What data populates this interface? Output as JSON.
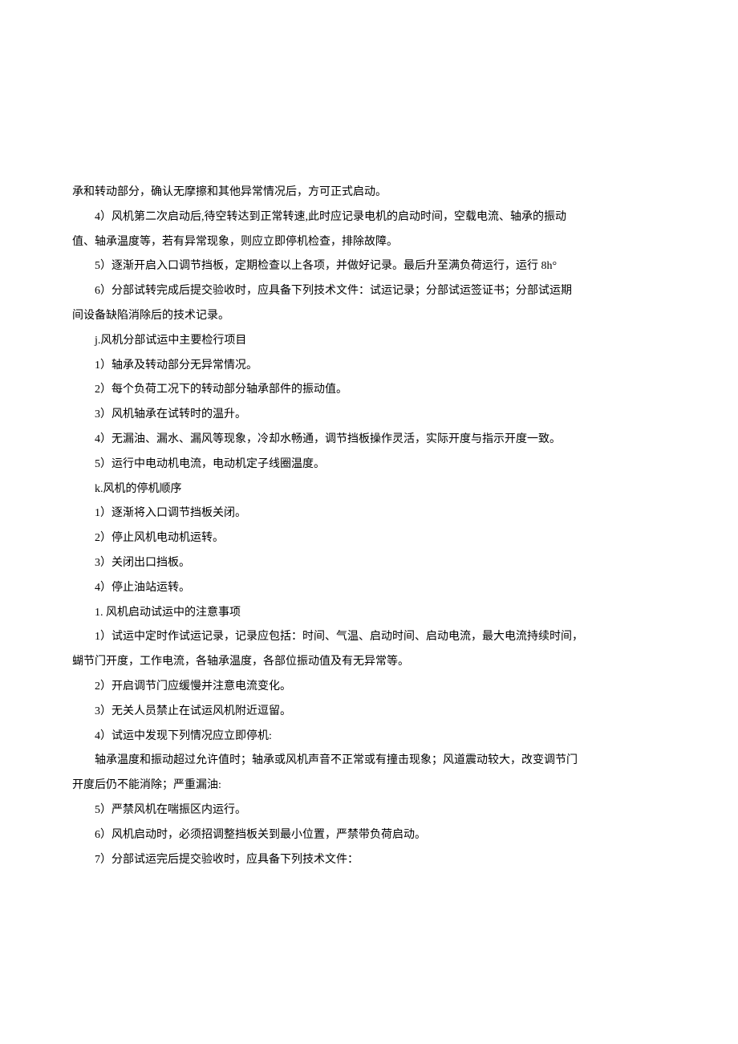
{
  "lines": [
    {
      "text": "承和转动部分，确认无摩擦和其他异常情况后，方可正式启动。",
      "indent": false
    },
    {
      "text": "4）风机第二次启动后,待空转达到正常转速,此时应记录电机的启动时间，空载电流、轴承的振动",
      "indent": true
    },
    {
      "text": "值、轴承温度等，若有异常现象，则应立即停机检查，排除故障。",
      "indent": false
    },
    {
      "text": "5）逐渐开启入口调节挡板，定期检查以上各项，并做好记录。最后升至满负荷运行，运行 8h°",
      "indent": true
    },
    {
      "text": "6）分部试转完成后提交验收时，应具备下列技术文件：试运记录；分部试运签证书；分部试运期",
      "indent": true
    },
    {
      "text": "间设备缺陷消除后的技术记录。",
      "indent": false
    },
    {
      "text": "j.风机分部试运中主要检行项目",
      "indent": true
    },
    {
      "text": "1）轴承及转动部分无异常情况。",
      "indent": true
    },
    {
      "text": "2）每个负荷工况下的转动部分轴承部件的振动值。",
      "indent": true
    },
    {
      "text": "3）风机轴承在试转时的温升。",
      "indent": true
    },
    {
      "text": "4）无漏油、漏水、漏风等现象，冷却水畅通，调节挡板操作灵活，实际开度与指示开度一致。",
      "indent": true
    },
    {
      "text": "5）运行中电动机电流，电动机定子线圈温度。",
      "indent": true
    },
    {
      "text": "k.风机的停机顺序",
      "indent": true
    },
    {
      "text": "1）逐渐将入口调节挡板关闭。",
      "indent": true
    },
    {
      "text": "2）停止风机电动机运转。",
      "indent": true
    },
    {
      "text": "3）关闭出口挡板。",
      "indent": true
    },
    {
      "text": "4）停止油站运转。",
      "indent": true
    },
    {
      "text": "1. 风机启动试运中的注意事项",
      "indent": true
    },
    {
      "text": "1）试运中定时作试运记录，记录应包括：时间、气温、启动时间、启动电流，最大电流持续时间，",
      "indent": true
    },
    {
      "text": "蝴节门开度，工作电流，各轴承温度，各部位振动值及有无异常等。",
      "indent": false
    },
    {
      "text": "2）开启调节门应缓慢并注意电流变化。",
      "indent": true
    },
    {
      "text": "3）无关人员禁止在试运风机附近逗留。",
      "indent": true
    },
    {
      "text": "4）试运中发现下列情况应立即停机:",
      "indent": true
    },
    {
      "text": "轴承温度和振动超过允许值时；轴承或风机声音不正常或有撞击现象；风道震动较大，改变调节门",
      "indent": true
    },
    {
      "text": "开度后仍不能消除；严重漏油:",
      "indent": false
    },
    {
      "text": "5）严禁风机在喘振区内运行。",
      "indent": true
    },
    {
      "text": "6）风机启动时，必须招调整挡板关到最小位置，严禁带负荷启动。",
      "indent": true
    },
    {
      "text": "7）分部试运完后提交验收时，应具备下列技术文件：",
      "indent": true
    }
  ]
}
